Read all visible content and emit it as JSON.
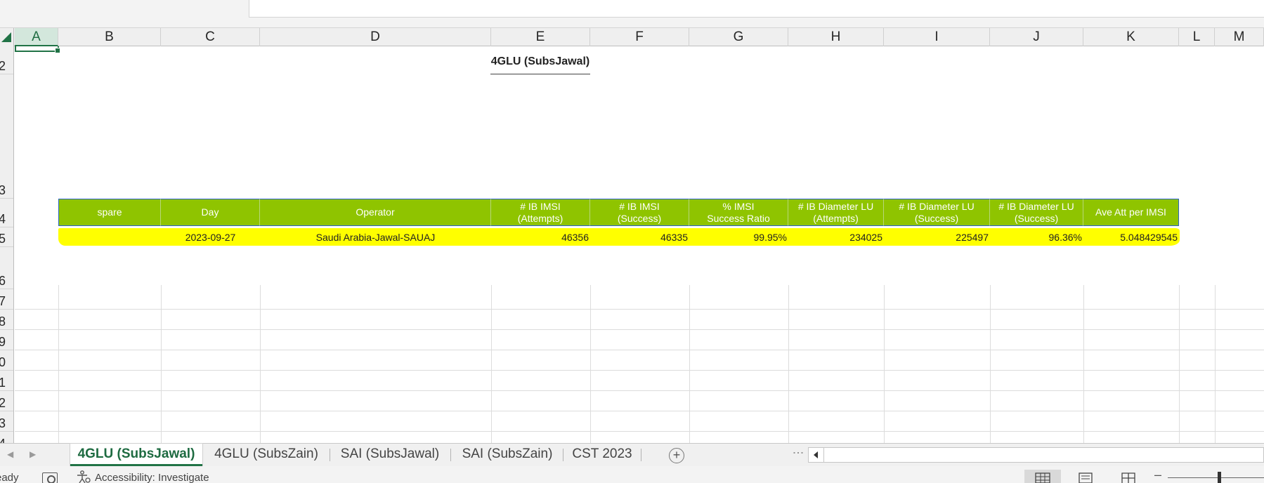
{
  "columns": [
    "A",
    "B",
    "C",
    "D",
    "E",
    "F",
    "G",
    "H",
    "I",
    "J",
    "K",
    "L",
    "M"
  ],
  "active_column": "A",
  "rows": [
    "2",
    "3",
    "4",
    "5",
    "6",
    "7",
    "8",
    "9",
    "0",
    "1",
    "2",
    "3",
    "4"
  ],
  "sheet_title": "4GLU (SubsJawal)",
  "table": {
    "headers": [
      "spare",
      "Day",
      "Operator",
      "# IB IMSI\n(Attempts)",
      "# IB IMSI\n(Success)",
      "% IMSI\nSuccess Ratio",
      "# IB Diameter LU\n(Attempts)",
      "# IB Diameter LU\n(Success)",
      "# IB Diameter LU\n(Success)",
      "Ave Att per IMSI"
    ],
    "row": [
      "",
      "2023-09-27",
      "Saudi Arabia-Jawal-SAUAJ",
      "46356",
      "46335",
      "99.95%",
      "234025",
      "225497",
      "96.36%",
      "5.048429545"
    ],
    "header_color": "#8fc400",
    "highlight_color": "#ffff00"
  },
  "sheet_tabs": [
    "4GLU (SubsJawal)",
    "4GLU (SubsZain)",
    "SAI (SubsJawal)",
    "SAI (SubsZain)",
    "CST 2023"
  ],
  "active_tab": "4GLU (SubsJawal)",
  "status": {
    "ready": "eady",
    "accessibility": "Accessibility: Investigate"
  },
  "colors": {
    "excel_green": "#217346",
    "table_border": "#2b63c6"
  }
}
